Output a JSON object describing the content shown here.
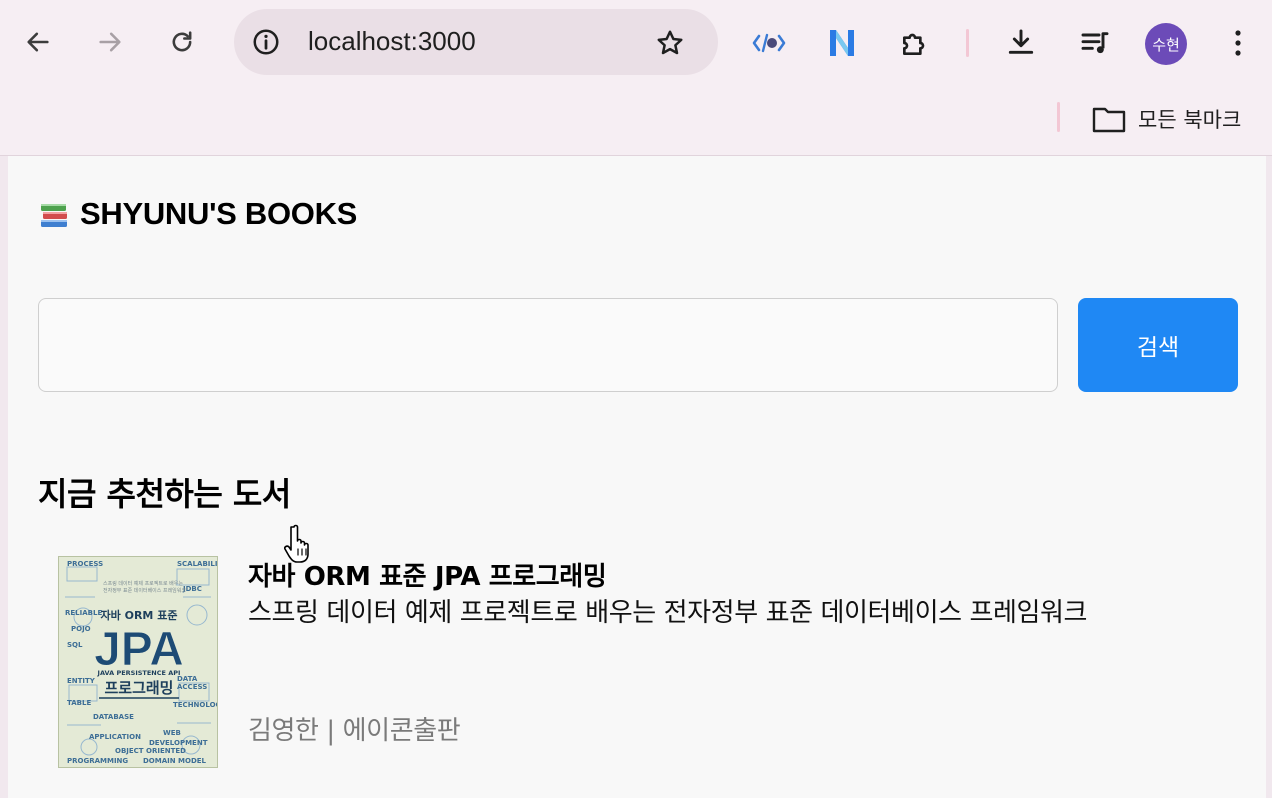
{
  "browser": {
    "url": "localhost:3000",
    "avatar_text": "수현",
    "bookmarks_all_label": "모든 북마크"
  },
  "icons": {
    "back": "arrow-left-icon",
    "forward": "arrow-right-icon",
    "reload": "reload-icon",
    "site_info": "tune-icon",
    "bookmark_star": "star-icon",
    "extensions": [
      "code-extension-icon",
      "n-extension-icon",
      "puzzle-icon"
    ],
    "downloads": "download-icon",
    "media": "playlist-icon",
    "menu": "kebab-menu-icon",
    "folder": "folder-icon",
    "brand": "books-icon"
  },
  "app": {
    "brand_title": "SHYUNU'S BOOKS",
    "search_placeholder": "",
    "search_button_label": "검색",
    "section_title": "지금 추천하는 도서"
  },
  "books": [
    {
      "title": "자바 ORM 표준 JPA 프로그래밍",
      "description": "스프링 데이터 예제 프로젝트로 배우는 전자정부 표준 데이터베이스 프레임워크",
      "author": "김영한",
      "publisher": "에이콘출판",
      "meta_separator": " | ",
      "cover_texts": {
        "top": "자바 ORM 표준",
        "big": "JPA",
        "sub": "JAVA PERSISTENCE API",
        "kr": "프로그래밍"
      }
    }
  ],
  "colors": {
    "chrome_bg": "#f6eef3",
    "omnibox_bg": "#eadfe6",
    "page_bg": "#f8f8f8",
    "accent": "#1f88f4",
    "avatar": "#6c4bb8",
    "muted_text": "#7a7a7a"
  }
}
